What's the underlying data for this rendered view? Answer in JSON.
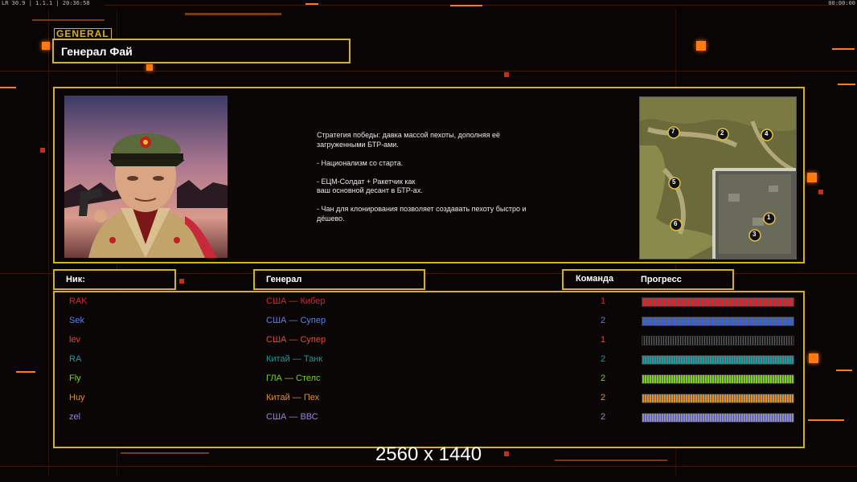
{
  "hud": {
    "top_left": "LR 30.9 | 1.1.1 | 20:36:58",
    "top_right": "00:00:00"
  },
  "general": {
    "tag": "GENERAL",
    "name": "Генерал Фай",
    "description": "Стратегия победы: давка массой пехоты, дополняя её\n загруженными БТР-ами.\n\n- Национализм со старта.\n\n- ЕЦМ-Солдат + Ракетчик как\nваш основной десант в БТР-ах.\n\n- Чан для клонирования позволяет создавать пехоту быстро и\n дёшево."
  },
  "minimap": {
    "start_positions": [
      "7",
      "2",
      "4",
      "5",
      "1",
      "6",
      "3"
    ]
  },
  "table": {
    "headers": {
      "nick": "Ник:",
      "general": "Генерал",
      "team": "Команда",
      "progress": "Прогресс"
    },
    "rows": [
      {
        "nick": "RAK",
        "general": "США — Кибер",
        "team": "1",
        "color": "#e0202a",
        "nick_color": "#e0202a",
        "gen_color": "#e0202a",
        "team_color": "#e0202a",
        "progress": 1.0
      },
      {
        "nick": "Sek",
        "general": "США — Супер",
        "team": "2",
        "color": "#3a62d8",
        "nick_color": "#5a7ff0",
        "gen_color": "#5a7ff0",
        "team_color": "#5a7ff0",
        "progress": 1.0
      },
      {
        "nick": "lev",
        "general": "США — Супер",
        "team": "1",
        "color": "#1a1a1a",
        "nick_color": "#e04a3a",
        "gen_color": "#e04a3a",
        "team_color": "#e04a3a",
        "progress": 1.0
      },
      {
        "nick": "RA",
        "general": "Китай — Танк",
        "team": "2",
        "color": "#1a9aa0",
        "nick_color": "#1a9aa0",
        "gen_color": "#1a9aa0",
        "team_color": "#1a9aa0",
        "progress": 1.0
      },
      {
        "nick": "Fly",
        "general": "ГЛА — Стелс",
        "team": "2",
        "color": "#7ad020",
        "nick_color": "#7ad020",
        "gen_color": "#7ad020",
        "team_color": "#7ad020",
        "progress": 1.0
      },
      {
        "nick": "Huy",
        "general": "Китай — Пех",
        "team": "2",
        "color": "#e0902a",
        "nick_color": "#e0902a",
        "gen_color": "#e0902a",
        "team_color": "#e0902a",
        "progress": 1.0
      },
      {
        "nick": "zel",
        "general": "США — ВВС",
        "team": "2",
        "color": "#8a8ae0",
        "nick_color": "#8a8ae0",
        "gen_color": "#8a8ae0",
        "team_color": "#8a8ae0",
        "progress": 1.0
      }
    ]
  },
  "watermark": "2560 x 1440",
  "colors": {
    "accent": "#d4b21c",
    "background": "#090505",
    "highlight": "#ff7a10"
  }
}
